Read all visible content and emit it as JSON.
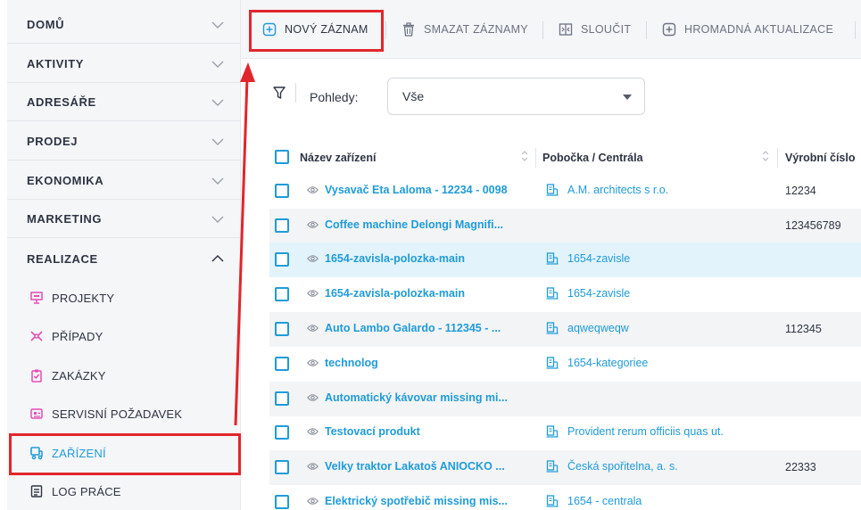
{
  "sidebar": {
    "sections": [
      {
        "label": "DOMŮ",
        "expanded": false
      },
      {
        "label": "AKTIVITY",
        "expanded": false
      },
      {
        "label": "ADRESÁŘE",
        "expanded": false
      },
      {
        "label": "PRODEJ",
        "expanded": false
      },
      {
        "label": "EKONOMIKA",
        "expanded": false
      },
      {
        "label": "MARKETING",
        "expanded": false
      },
      {
        "label": "REALIZACE",
        "expanded": true
      }
    ],
    "sub_items": [
      {
        "label": "PROJEKTY",
        "icon": "projector-icon",
        "color": "#e44bb5"
      },
      {
        "label": "PŘÍPADY",
        "icon": "case-icon",
        "color": "#e44bb5"
      },
      {
        "label": "ZAKÁZKY",
        "icon": "clipboard-check-icon",
        "color": "#e44bb5"
      },
      {
        "label": "SERVISNÍ POŽADAVEK",
        "icon": "service-request-icon",
        "color": "#e44bb5"
      },
      {
        "label": "ZAŘÍZENÍ",
        "icon": "device-icon",
        "color": "#1f9bd8",
        "active": true
      },
      {
        "label": "LOG PRÁCE",
        "icon": "work-log-icon",
        "color": "#2d3442"
      }
    ]
  },
  "toolbar": {
    "new_record": "NOVÝ ZÁZNAM",
    "delete_records": "SMAZAT ZÁZNAMY",
    "merge": "SLOUČIT",
    "bulk_update": "HROMADNÁ AKTUALIZACE"
  },
  "filter": {
    "label": "Pohledy:",
    "selected": "Vše"
  },
  "table": {
    "columns": [
      "Název zařízení",
      "Pobočka / Centrála",
      "Výrobní číslo"
    ],
    "rows": [
      {
        "name": "Vysavač Eta Laloma - 12234 - 0098",
        "branch": "A.M. architects s r.o.",
        "serial": "12234"
      },
      {
        "name": "Coffee machine Delongi Magnifi...",
        "branch": "",
        "serial": "123456789"
      },
      {
        "name": "1654-zavisla-polozka-main",
        "branch": "1654-zavisle",
        "serial": ""
      },
      {
        "name": "1654-zavisla-polozka-main",
        "branch": "1654-zavisle",
        "serial": ""
      },
      {
        "name": "Auto Lambo Galardo - 112345 - ...",
        "branch": "aqweqweqw",
        "serial": "112345"
      },
      {
        "name": "technolog",
        "branch": "1654-kategoriee",
        "serial": ""
      },
      {
        "name": "Automatický kávovar missing mi...",
        "branch": "",
        "serial": ""
      },
      {
        "name": "Testovací produkt",
        "branch": "Provident rerum officiis quas ut.",
        "serial": ""
      },
      {
        "name": "Velky traktor Lakatoš ANIOCKO ...",
        "branch": "Česká spořitelna, a. s.",
        "serial": "22333"
      },
      {
        "name": "Elektrický spotřebič missing mis...",
        "branch": "1654 - centrala",
        "serial": ""
      }
    ]
  },
  "colors": {
    "accent": "#1f9bd8",
    "highlight": "#e0262b",
    "sub_icon": "#e44bb5"
  }
}
